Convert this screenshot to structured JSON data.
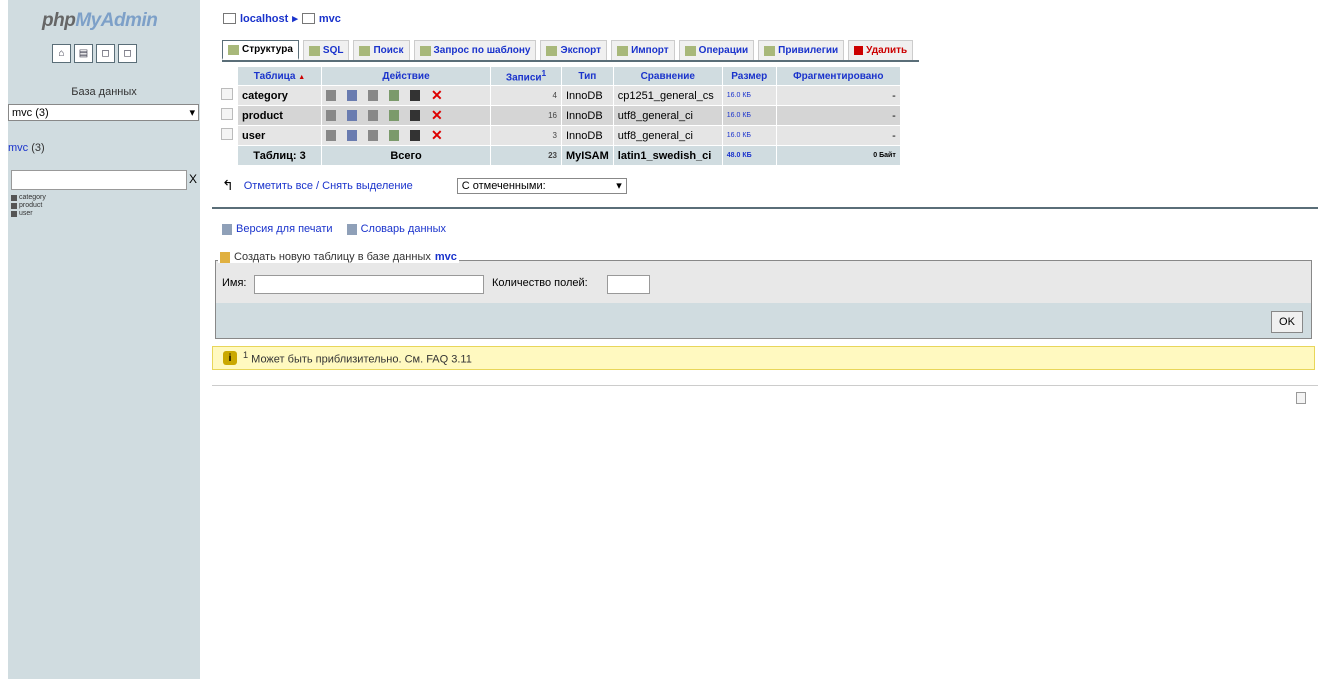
{
  "sidebar": {
    "logo_php": "php",
    "logo_myadmin": "MyAdmin",
    "db_label": "База данных",
    "db_select": "mvc (3)",
    "db_link": "mvc",
    "db_link_count": "(3)",
    "filter_clear": "X",
    "tables": [
      "category",
      "product",
      "user"
    ]
  },
  "breadcrumb": {
    "server": "localhost",
    "sep": "▸",
    "db": "mvc"
  },
  "tabs": [
    {
      "label": "Структура",
      "active": true
    },
    {
      "label": "SQL"
    },
    {
      "label": "Поиск"
    },
    {
      "label": "Запрос по шаблону"
    },
    {
      "label": "Экспорт"
    },
    {
      "label": "Импорт"
    },
    {
      "label": "Операции"
    },
    {
      "label": "Привилегии"
    },
    {
      "label": "Удалить"
    }
  ],
  "table": {
    "headers": {
      "table": "Таблица",
      "sort": "▲",
      "action": "Действие",
      "records": "Записи",
      "records_sup": "1",
      "type": "Тип",
      "collation": "Сравнение",
      "size": "Размер",
      "overhead": "Фрагментировано"
    },
    "rows": [
      {
        "name": "category",
        "records": "4",
        "type": "InnoDB",
        "collation": "cp1251_general_cs",
        "size": "16.0 КБ",
        "overhead": "-"
      },
      {
        "name": "product",
        "records": "16",
        "type": "InnoDB",
        "collation": "utf8_general_ci",
        "size": "16.0 КБ",
        "overhead": "-"
      },
      {
        "name": "user",
        "records": "3",
        "type": "InnoDB",
        "collation": "utf8_general_ci",
        "size": "16.0 КБ",
        "overhead": "-"
      }
    ],
    "footer": {
      "tables": "Таблиц: 3",
      "total": "Всего",
      "records": "23",
      "type": "MyISAM",
      "collation": "latin1_swedish_ci",
      "size": "48.0 КБ",
      "overhead": "0 Байт"
    }
  },
  "select_all": "Отметить все / Снять выделение",
  "with_selected": "С отмеченными:",
  "links": {
    "print": "Версия для печати",
    "dictionary": "Словарь данных"
  },
  "create": {
    "legend": "Создать новую таблицу в базе данных",
    "db": "mvc",
    "name_label": "Имя:",
    "fields_label": "Количество полей:",
    "ok": "OK"
  },
  "notice": {
    "sup": "1",
    "text": "Может быть приблизительно. См. FAQ 3.11"
  },
  "colors": {
    "sidebar_bg": "#d0dce0",
    "link": "#1a33cc",
    "delete": "#cc0000",
    "notice_bg": "#fff9c0"
  }
}
